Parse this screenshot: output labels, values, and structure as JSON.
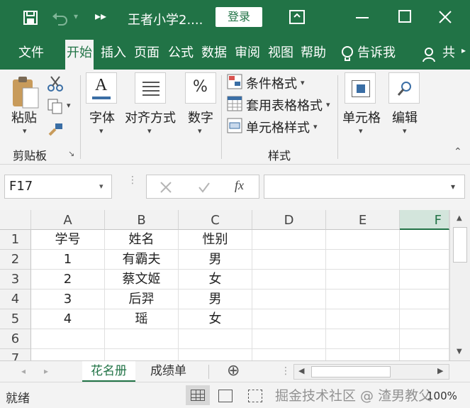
{
  "title_bar": {
    "file_title": "王者小学2....",
    "login_label": "登录"
  },
  "menu": {
    "tabs": [
      "文件",
      "开始",
      "插入",
      "页面",
      "公式",
      "数据",
      "审阅",
      "视图",
      "帮助"
    ],
    "tell_me": "告诉我",
    "share_label": "共"
  },
  "ribbon": {
    "clipboard": {
      "paste_label": "粘贴",
      "group_label": "剪贴板"
    },
    "font_label": "字体",
    "align_label": "对齐方式",
    "number_label": "数字",
    "styles": {
      "conditional_format": "条件格式",
      "table_format": "套用表格格式",
      "cell_styles": "单元格样式",
      "group_label": "样式"
    },
    "cells_label": "单元格",
    "editing_label": "编辑"
  },
  "formula_bar": {
    "name_box": "F17",
    "fx_label": "fx",
    "formula": ""
  },
  "grid": {
    "columns": [
      "A",
      "B",
      "C",
      "D",
      "E",
      "F"
    ],
    "row_numbers": [
      "1",
      "2",
      "3",
      "4",
      "5",
      "6",
      "7"
    ],
    "rows": [
      [
        "学号",
        "姓名",
        "性别",
        "",
        "",
        ""
      ],
      [
        "1",
        "有霸夫",
        "男",
        "",
        "",
        ""
      ],
      [
        "2",
        "蔡文姬",
        "女",
        "",
        "",
        ""
      ],
      [
        "3",
        "后羿",
        "男",
        "",
        "",
        ""
      ],
      [
        "4",
        "瑶",
        "女",
        "",
        "",
        ""
      ],
      [
        "",
        "",
        "",
        "",
        "",
        ""
      ]
    ]
  },
  "sheets": {
    "tabs": [
      "花名册",
      "成绩单"
    ],
    "add_label": "⊕"
  },
  "status": {
    "ready": "就绪",
    "zoom": "100%",
    "watermark": "掘金技术社区 @ 渣男教父"
  },
  "colors": {
    "brand": "#217346",
    "ribbon_bg": "#f3f3f3"
  }
}
